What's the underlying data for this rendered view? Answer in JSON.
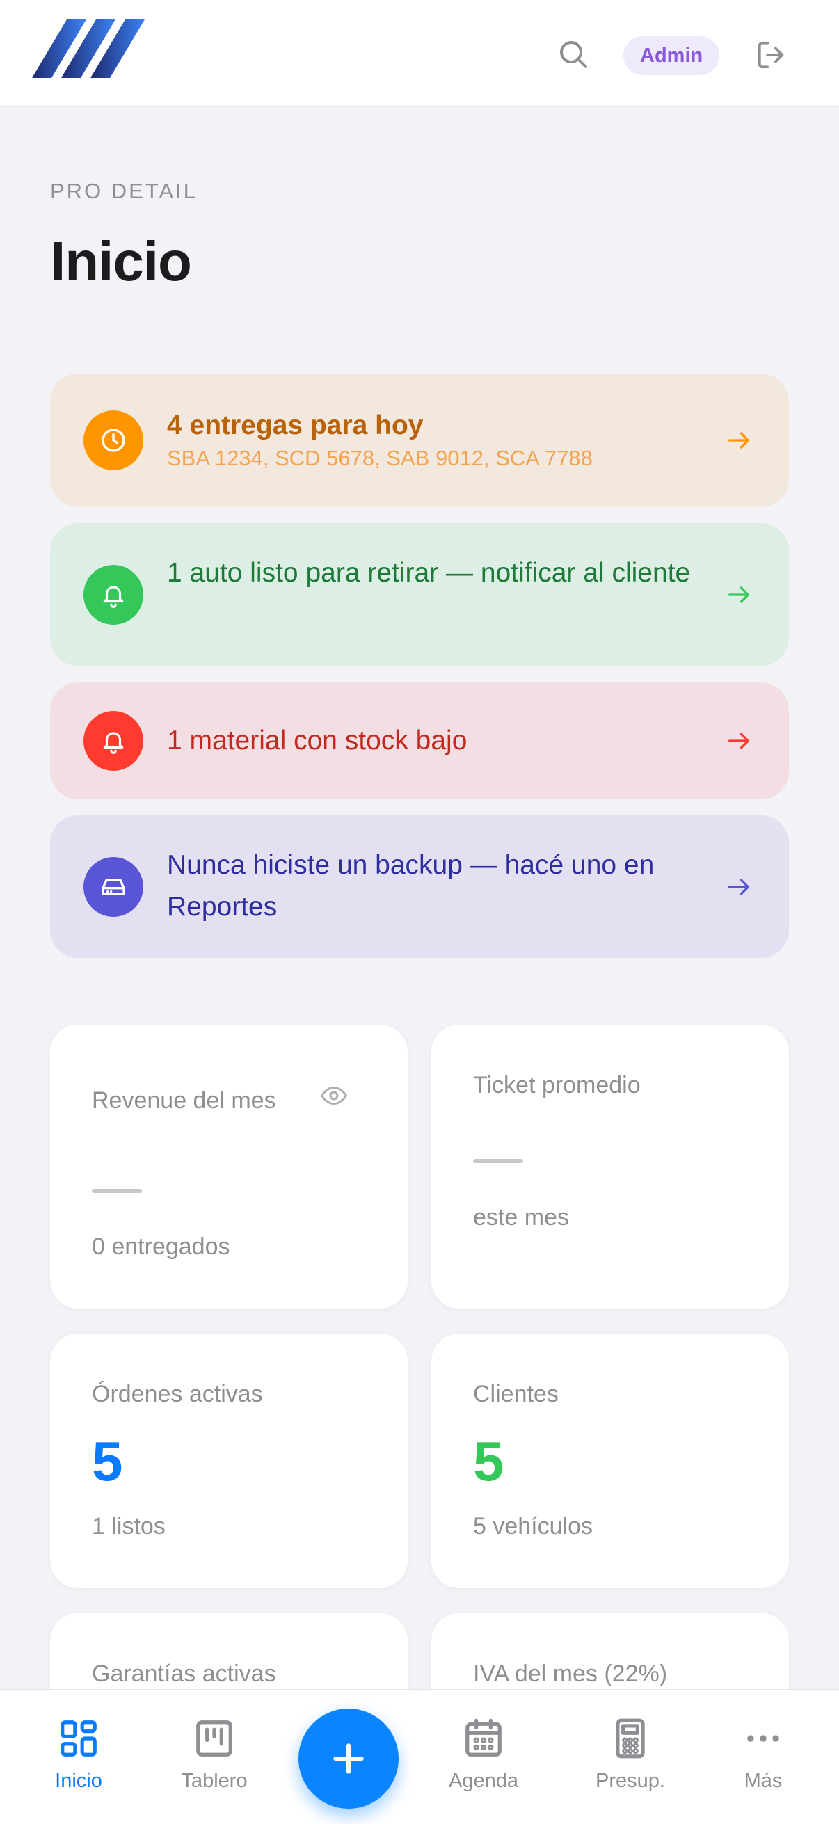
{
  "header": {
    "logo": "pro-detail-logo",
    "search_icon": "search-icon",
    "role_badge": "Admin",
    "logout_icon": "logout-icon"
  },
  "page": {
    "eyebrow": "PRO DETAIL",
    "title": "Inicio"
  },
  "alerts": [
    {
      "title": "4 entregas para hoy",
      "subtitle": "SBA 1234, SCD 5678, SAB 9012, SCA 7788",
      "icon": "clock-icon",
      "color": "#ff9500"
    },
    {
      "title": "1 auto listo para retirar — notificar al cliente",
      "icon": "bell-icon",
      "color": "#34c759"
    },
    {
      "title": "1 material con stock bajo",
      "icon": "bell-icon",
      "color": "#ff3b30"
    },
    {
      "title": "Nunca hiciste un backup — hacé uno en Reportes",
      "icon": "hard-drive-icon",
      "color": "#5856d6"
    }
  ],
  "stats": [
    {
      "label": "Revenue del mes",
      "value": "",
      "sub": "0 entregados",
      "icon": "eye-icon"
    },
    {
      "label": "Ticket promedio",
      "value": "",
      "sub": "este mes"
    },
    {
      "label": "Órdenes activas",
      "value": "5",
      "sub": "1 listos",
      "color": "#0a7aff"
    },
    {
      "label": "Clientes",
      "value": "5",
      "sub": "5 vehículos",
      "color": "#34c759"
    },
    {
      "label": "Garantías activas"
    },
    {
      "label": "IVA del mes (22%)"
    }
  ],
  "nav": {
    "items": [
      {
        "label": "Inicio",
        "icon": "grid-icon",
        "active": true
      },
      {
        "label": "Tablero",
        "icon": "kanban-icon"
      },
      {
        "label": "Agenda",
        "icon": "calendar-icon"
      },
      {
        "label": "Presup.",
        "icon": "calculator-icon"
      },
      {
        "label": "Más",
        "icon": "more-icon"
      }
    ],
    "fab_icon": "plus-icon"
  },
  "colors": {
    "accent": "#0a84ff",
    "background": "#f2f2f7"
  }
}
